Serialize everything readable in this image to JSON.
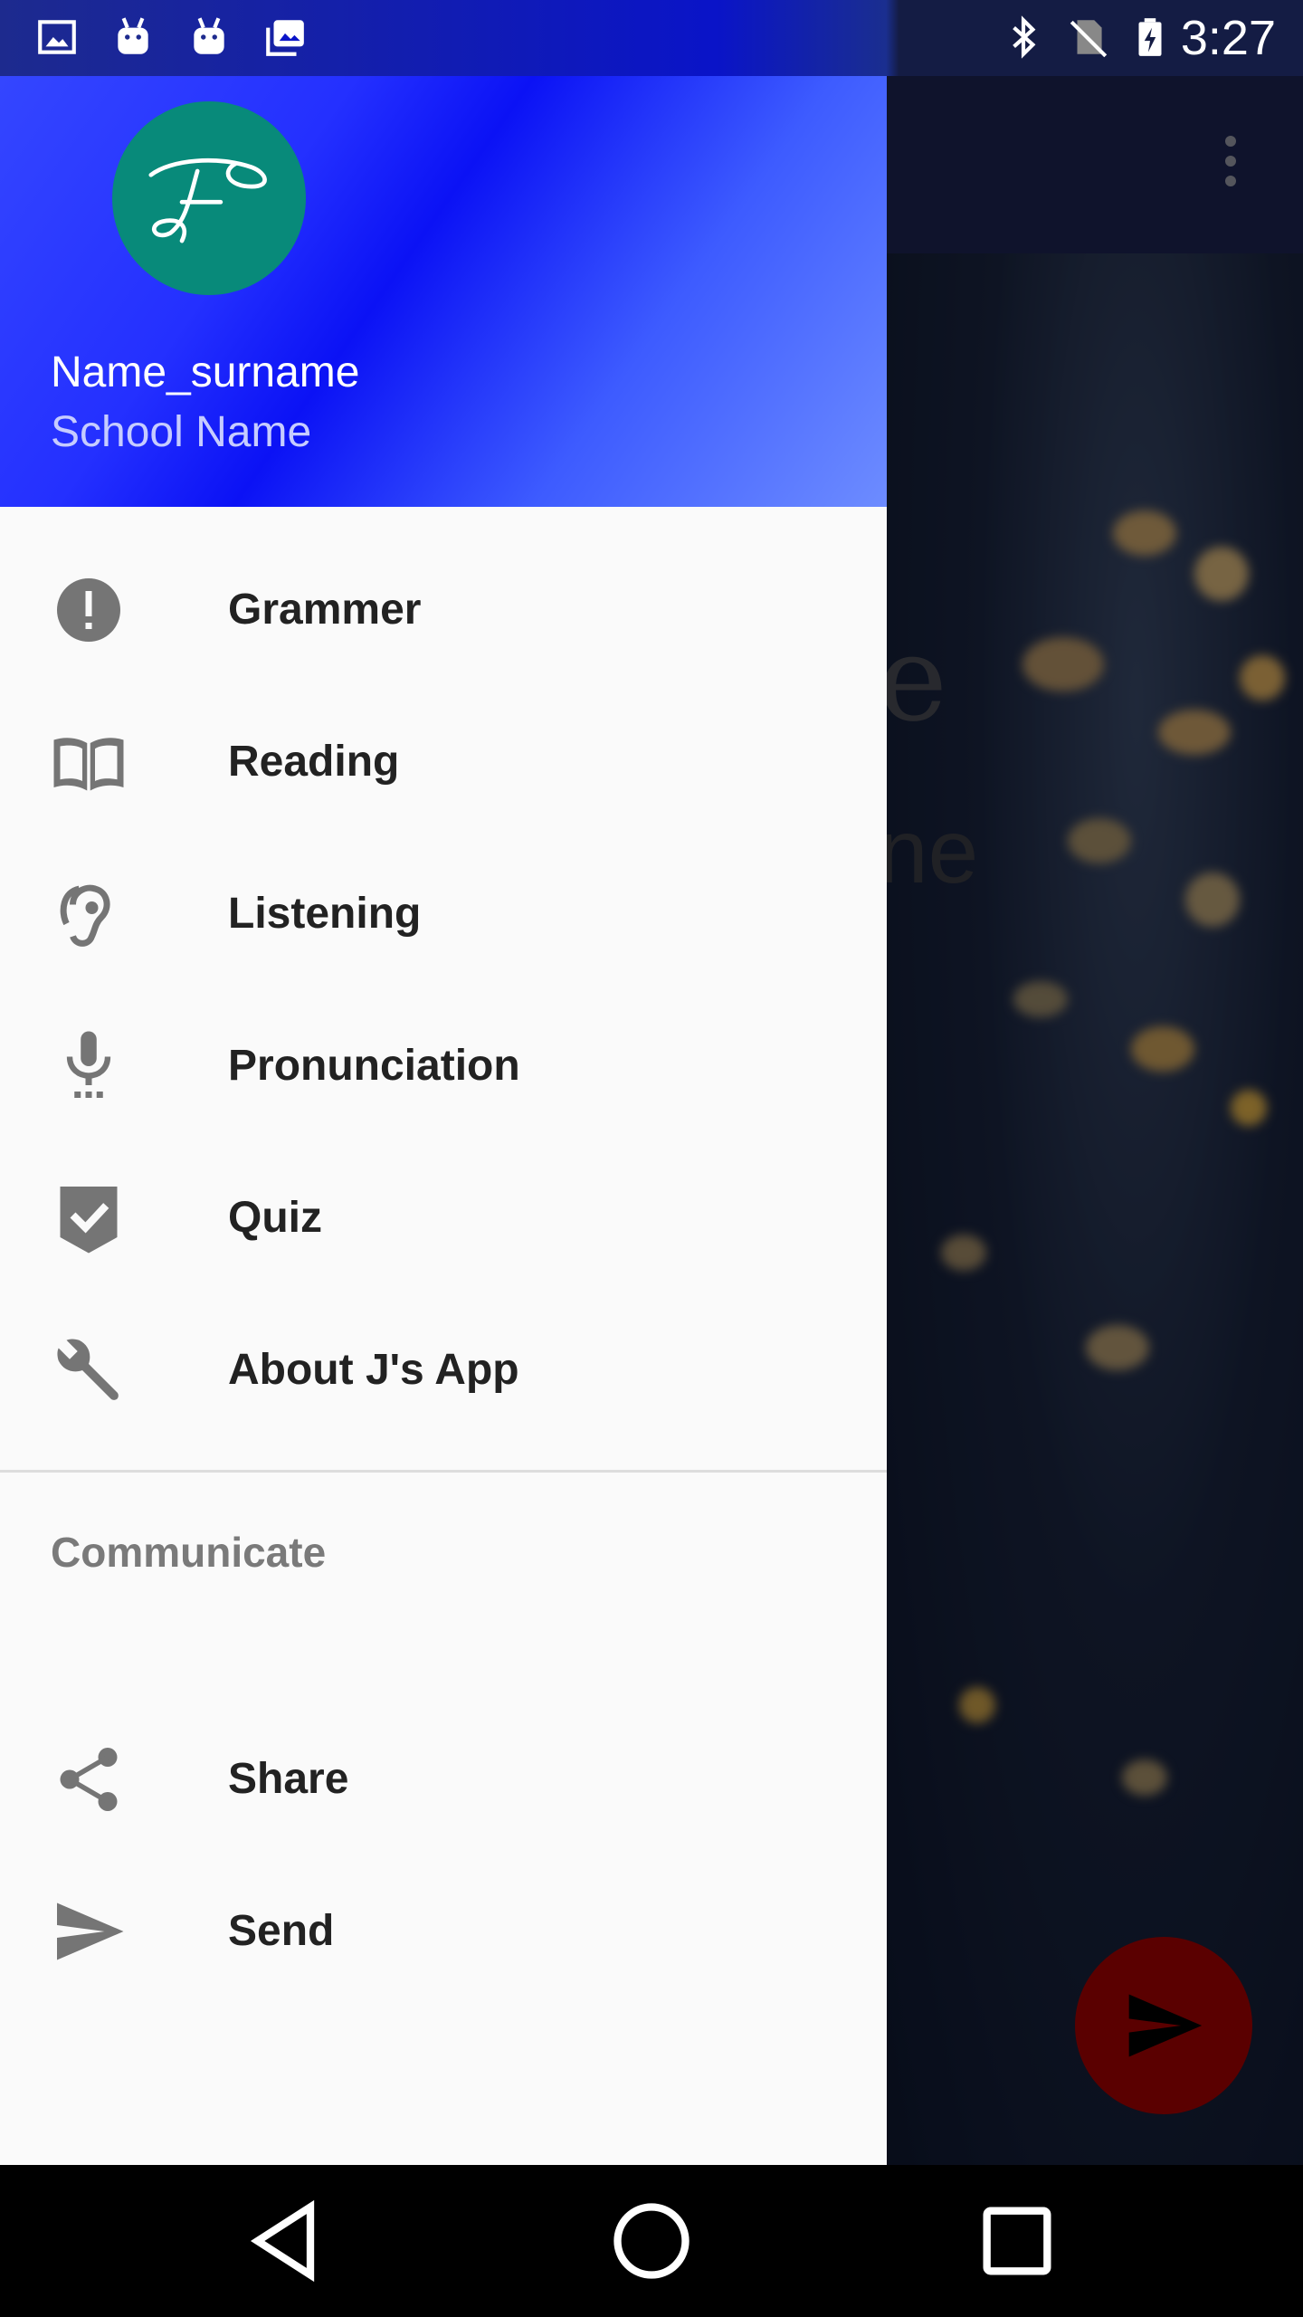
{
  "status_bar": {
    "time": "3:27",
    "left_icons": [
      "image-icon",
      "android-icon",
      "android-icon",
      "photo-library-icon"
    ],
    "right_icons": [
      "bluetooth-icon",
      "no-sim-icon",
      "battery-charging-icon"
    ]
  },
  "drawer": {
    "header": {
      "name": "Name_surname",
      "school": "School Name",
      "avatar_icon": "script-f-logo"
    },
    "items": [
      {
        "label": "Grammer",
        "icon": "exclamation-icon"
      },
      {
        "label": "Reading",
        "icon": "book-icon"
      },
      {
        "label": "Listening",
        "icon": "hearing-icon"
      },
      {
        "label": "Pronunciation",
        "icon": "microphone-icon"
      },
      {
        "label": "Quiz",
        "icon": "check-shield-icon"
      },
      {
        "label": "About J's App",
        "icon": "wrench-icon"
      }
    ],
    "section_title": "Communicate",
    "communicate_items": [
      {
        "label": "Share",
        "icon": "share-icon"
      },
      {
        "label": "Send",
        "icon": "send-icon"
      }
    ]
  },
  "background_app": {
    "title_fragment": "e",
    "subtitle_fragment": "ne",
    "fab_icon": "send-icon"
  },
  "navigation_bar": [
    "back-icon",
    "home-icon",
    "recents-icon"
  ],
  "colors": {
    "header_gradient_mid": "#0b12f5",
    "avatar": "#088a7a",
    "fab": "#5a0000"
  }
}
